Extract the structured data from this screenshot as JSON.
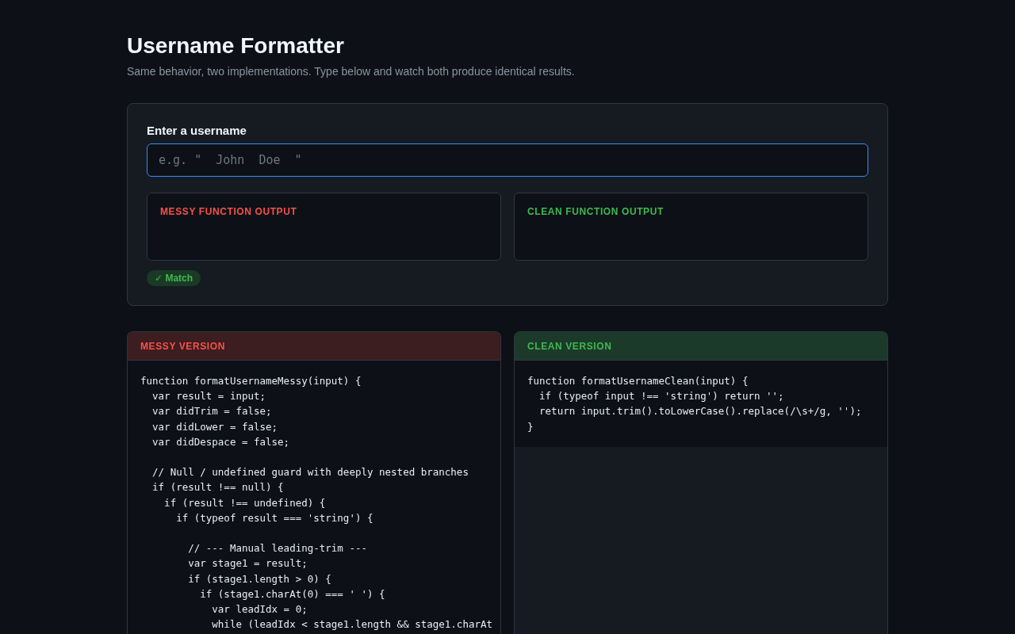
{
  "header": {
    "title": "Username Formatter",
    "subtitle": "Same behavior, two implementations. Type below and watch both produce identical results."
  },
  "input_card": {
    "field": {
      "label": "Enter a username",
      "placeholder": "e.g. \"  John  Doe  \"",
      "focused": true
    },
    "outputs": [
      {
        "kind": "messy",
        "label": "MESSY FUNCTION OUTPUT"
      },
      {
        "kind": "clean",
        "label": "CLEAN FUNCTION OUTPUT"
      }
    ],
    "status": {
      "match": true,
      "text": "✓ Match"
    }
  },
  "code_panels": [
    {
      "kind": "messy",
      "title": "MESSY VERSION",
      "code": "function formatUsernameMessy(input) {\n  var result = input;\n  var didTrim = false;\n  var didLower = false;\n  var didDespace = false;\n\n  // Null / undefined guard with deeply nested branches\n  if (result !== null) {\n    if (result !== undefined) {\n      if (typeof result === 'string') {\n\n        // --- Manual leading-trim ---\n        var stage1 = result;\n        if (stage1.length > 0) {\n          if (stage1.charAt(0) === ' ') {\n            var leadIdx = 0;\n            while (leadIdx < stage1.length && stage1.charAt"
    },
    {
      "kind": "clean",
      "title": "CLEAN VERSION",
      "code": "function formatUsernameClean(input) {\n  if (typeof input !== 'string') return '';\n  return input.trim().toLowerCase().replace(/\\s+/g, '');\n}"
    }
  ]
}
